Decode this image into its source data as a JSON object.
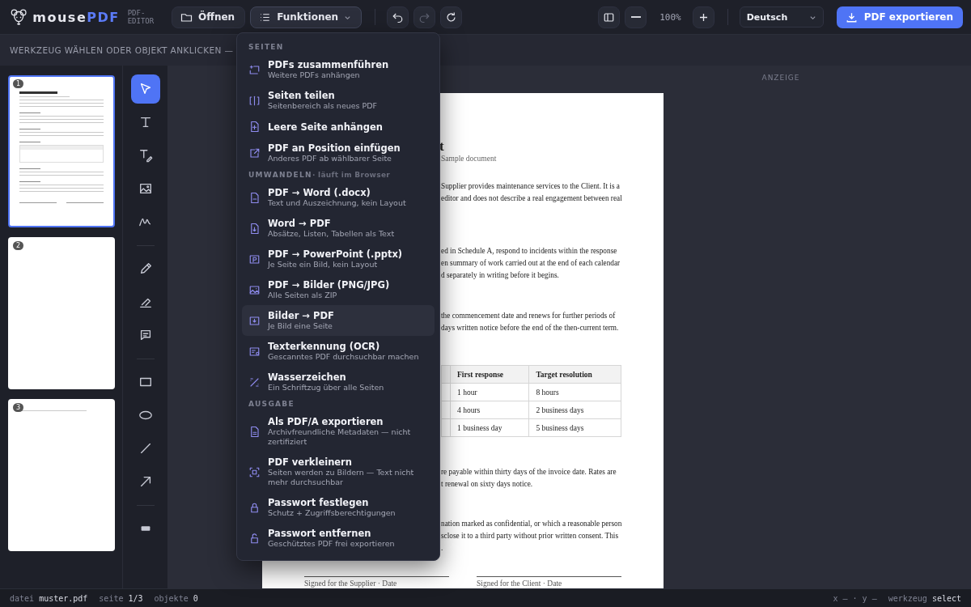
{
  "logo": {
    "name_prefix": "mouse",
    "name_accent": "PDF",
    "tagline": "PDF-EDITOR"
  },
  "toolbar": {
    "open_label": "Öffnen",
    "functions_label": "Funktionen",
    "functions_expanded": true,
    "redo_disabled": true,
    "zoom": "100%",
    "language": "Deutsch",
    "export_label": "PDF exportieren"
  },
  "hint": "WERKZEUG WÄHLEN ODER OBJEKT ANKLICKEN —",
  "pages": [
    {
      "number": "1",
      "selected": true,
      "kind": "content"
    },
    {
      "number": "2",
      "selected": false,
      "kind": "blank"
    },
    {
      "number": "3",
      "selected": false,
      "kind": "line"
    }
  ],
  "tool_groups": [
    {
      "tools": [
        {
          "selected": true
        },
        {
          "selected": false
        },
        {
          "selected": false
        },
        {
          "selected": false
        },
        {
          "selected": false
        }
      ]
    },
    {
      "tools": [
        {
          "selected": false
        },
        {
          "selected": false
        },
        {
          "selected": false
        }
      ]
    },
    {
      "tools": [
        {
          "selected": false
        },
        {
          "selected": false
        },
        {
          "selected": false
        },
        {
          "selected": false
        }
      ]
    },
    {
      "tools": [
        {
          "selected": false
        }
      ]
    }
  ],
  "canvas": {
    "side_label": "ANZEIGE"
  },
  "document": {
    "blocks": [
      {
        "kind": "title",
        "text": "t"
      },
      {
        "kind": "subtitle",
        "text": "Sample document"
      },
      {
        "kind": "paragraph",
        "text": "Supplier provides maintenance services to the Client. It is a\neditor and does not describe a real engagement between real"
      },
      {
        "kind": "paragraph",
        "text": "ed in Schedule A, respond to incidents within the response\nen summary of work carried out at the end of each calendar\nd separately in writing before it begins."
      },
      {
        "kind": "paragraph",
        "text": "the commencement date and renews for further periods of\ndays written notice before the end of the then-current term."
      },
      {
        "kind": "table",
        "header": [
          "First response",
          "Target resolution"
        ],
        "rows": [
          [
            "1 hour",
            "8 hours"
          ],
          [
            "4 hours",
            "2 business days"
          ],
          [
            "1 business day",
            "5 business days"
          ]
        ]
      },
      {
        "kind": "paragraph",
        "text": "re payable within thirty days of the invoice date. Rates are\nt renewal on sixty days notice."
      },
      {
        "kind": "paragraph",
        "text": "nation marked as confidential, or which a reasonable person\nsclose it to a third party without prior written consent. This\n."
      },
      {
        "kind": "signatures",
        "labels": [
          "Signed for the Supplier · Date",
          "Signed for the Client · Date"
        ]
      }
    ]
  },
  "menu": {
    "sections": [
      {
        "title": "SEITEN",
        "items": [
          {
            "label": "PDFs zusammenführen",
            "description": "Weitere PDFs anhängen",
            "selected": false
          },
          {
            "label": "Seiten teilen",
            "description": "Seitenbereich als neues PDF",
            "selected": false
          },
          {
            "label": "Leere Seite anhängen",
            "selected": false
          },
          {
            "label": "PDF an Position einfügen",
            "description": "Anderes PDF ab wählbarer Seite",
            "selected": false
          }
        ]
      },
      {
        "title": "UMWANDELN",
        "note": "· läuft im Browser",
        "items": [
          {
            "label": "PDF → Word (.docx)",
            "description": "Text und Auszeichnung, kein Layout",
            "selected": false
          },
          {
            "label": "Word → PDF",
            "description": "Absätze, Listen, Tabellen als Text",
            "selected": false
          },
          {
            "label": "PDF → PowerPoint (.pptx)",
            "description": "Je Seite ein Bild, kein Layout",
            "selected": false
          },
          {
            "label": "PDF → Bilder (PNG/JPG)",
            "description": "Alle Seiten als ZIP",
            "selected": false
          },
          {
            "label": "Bilder → PDF",
            "description": "Je Bild eine Seite",
            "selected": true
          },
          {
            "label": "Texterkennung (OCR)",
            "description": "Gescanntes PDF durchsuchbar machen",
            "selected": false
          },
          {
            "label": "Wasserzeichen",
            "description": "Ein Schriftzug über alle Seiten",
            "selected": false
          }
        ]
      },
      {
        "title": "AUSGABE",
        "items": [
          {
            "label": "Als PDF/A exportieren",
            "description": "Archivfreundliche Metadaten — nicht zertifiziert",
            "selected": false
          },
          {
            "label": "PDF verkleinern",
            "description": "Seiten werden zu Bildern — Text nicht mehr durchsuchbar",
            "selected": false
          },
          {
            "label": "Passwort festlegen",
            "description": "Schutz + Zugriffsberechtigungen",
            "selected": false
          },
          {
            "label": "Passwort entfernen",
            "description": "Geschütztes PDF frei exportieren",
            "selected": false
          }
        ]
      }
    ]
  },
  "status": {
    "file_label": "datei",
    "file": "muster.pdf",
    "page_label": "seite",
    "page": "1/3",
    "objects_label": "objekte",
    "objects": "0",
    "coords": "x – · y –",
    "tool_label": "werkzeug",
    "tool": "select"
  }
}
